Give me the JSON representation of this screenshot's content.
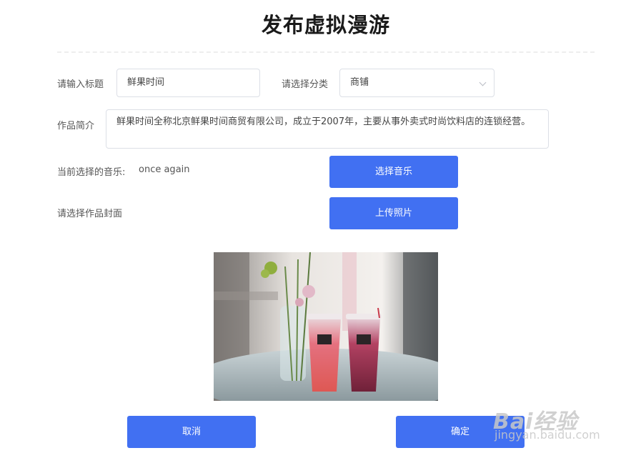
{
  "header": {
    "title": "发布虚拟漫游"
  },
  "form": {
    "title_label": "请输入标题",
    "title_value": "鲜果时间",
    "category_label": "请选择分类",
    "category_value": "商铺",
    "intro_label": "作品简介",
    "intro_value": "鲜果时间全称北京鲜果时间商贸有限公司，成立于2007年，主要从事外卖式时尚饮料店的连锁经营。",
    "music_label": "当前选择的音乐:",
    "music_value": "once again",
    "music_button": "选择音乐",
    "cover_label": "请选择作品封面",
    "upload_button": "上传照片"
  },
  "footer": {
    "cancel_label": "取消",
    "confirm_label": "确定"
  },
  "watermark": {
    "top": "Bai经验",
    "bottom": "jingyan.baidu.com"
  },
  "colors": {
    "primary": "#4170f2",
    "border": "#dcdfe6"
  }
}
